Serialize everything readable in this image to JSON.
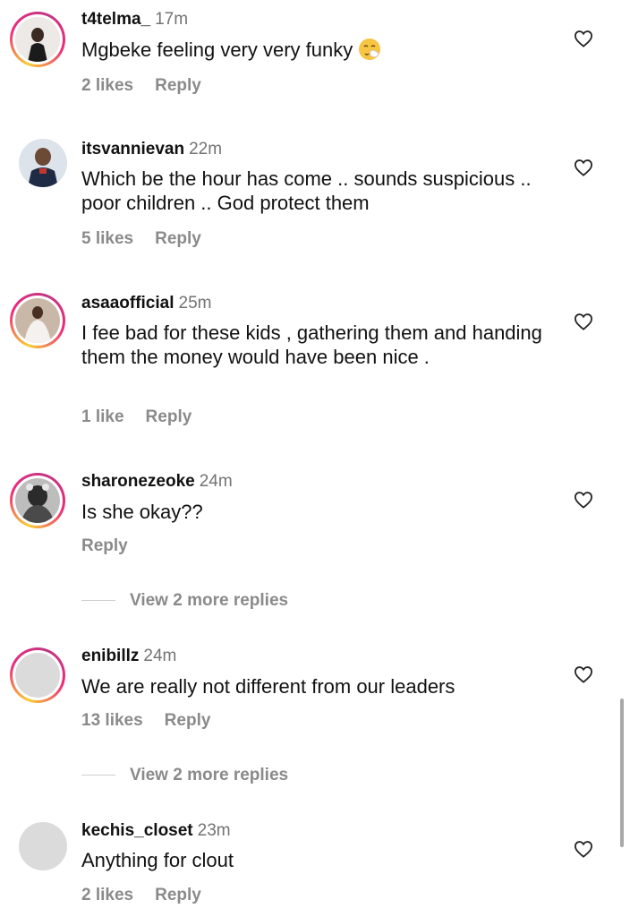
{
  "comments": [
    {
      "username": "t4telma_",
      "time": "17m",
      "text": "Mgbeke feeling very very funky",
      "emoji": "sneezing-face-emoji",
      "likes": "2 likes",
      "reply": "Reply"
    },
    {
      "username": "itsvannievan",
      "time": "22m",
      "text": "Which be the hour has come .. sounds suspicious .. poor children .. God protect them",
      "likes": "5 likes",
      "reply": "Reply"
    },
    {
      "username": "asaaofficial",
      "time": "25m",
      "text": "I fee bad for these kids , gathering them and handing them the money would have been nice .",
      "likes": "1 like",
      "reply": "Reply"
    },
    {
      "username": "sharonezeoke",
      "time": "24m",
      "text": "Is she okay??",
      "reply": "Reply",
      "view_replies": "View 2 more replies"
    },
    {
      "username": "enibillz",
      "time": "24m",
      "text": "We are really not different from our leaders",
      "likes": "13 likes",
      "reply": "Reply",
      "view_replies": "View 2 more replies"
    },
    {
      "username": "kechis_closet",
      "time": "23m",
      "text": "Anything for clout",
      "likes": "2 likes",
      "reply": "Reply"
    }
  ],
  "colors": {
    "story_ring": "#ee2a7b",
    "secondary_text": "#8a8a8a",
    "primary_text": "#111111"
  }
}
